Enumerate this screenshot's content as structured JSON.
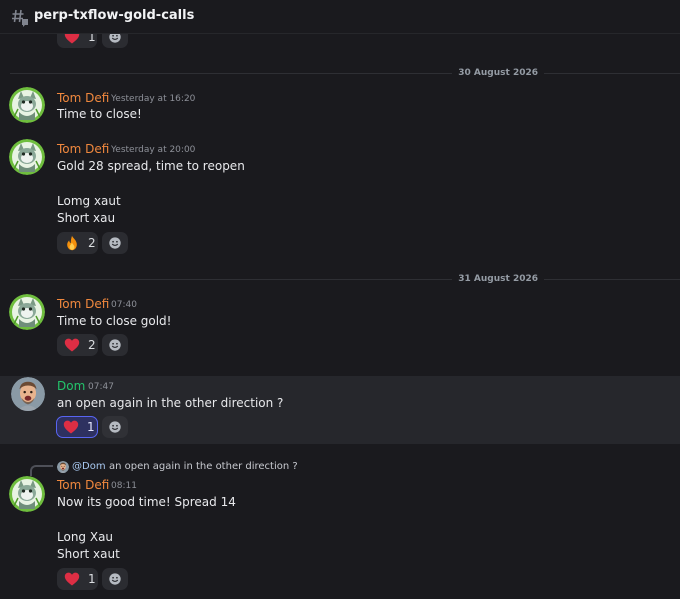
{
  "channel": {
    "name": "perp-txflow-gold-calls",
    "icon": "threads-hash-icon"
  },
  "top_partial": {
    "reaction_emoji": "heart-icon",
    "reaction_count": "1"
  },
  "dividers": {
    "first": "30 August 2026",
    "second": "31 August 2026"
  },
  "messages": [
    {
      "author": "Tom Defi",
      "time": "Yesterday at 16:20",
      "lines": [
        "Time to close!"
      ]
    },
    {
      "author": "Tom Defi",
      "time": "Yesterday at 20:00",
      "lines": [
        "Gold 28 spread, time to reopen",
        "Lomg xaut",
        "Short xau"
      ],
      "reaction": {
        "emoji": "fire-icon",
        "count": "2"
      }
    },
    {
      "author": "Tom Defi",
      "time": "07:40",
      "lines": [
        "Time to close gold!"
      ],
      "reaction": {
        "emoji": "heart-icon",
        "count": "2"
      }
    },
    {
      "author": "Dom",
      "time": "07:47",
      "lines": [
        "an open again in the other direction ?"
      ],
      "reaction": {
        "emoji": "heart-icon",
        "count": "1",
        "active": true
      }
    },
    {
      "reply": {
        "mention": "@Dom",
        "text": "an open again in the other direction ?"
      },
      "author": "Tom Defi",
      "time": "08:11",
      "lines": [
        "Now its good time! Spread 14",
        "Long Xau",
        "Short xaut"
      ],
      "reaction": {
        "emoji": "heart-icon",
        "count": "1"
      }
    }
  ],
  "colors": {
    "tom": "#f0883e",
    "dom": "#23c46b",
    "background": "#1a1a1e",
    "highlight": "#26272c",
    "reaction_active_border": "#5865f2"
  }
}
